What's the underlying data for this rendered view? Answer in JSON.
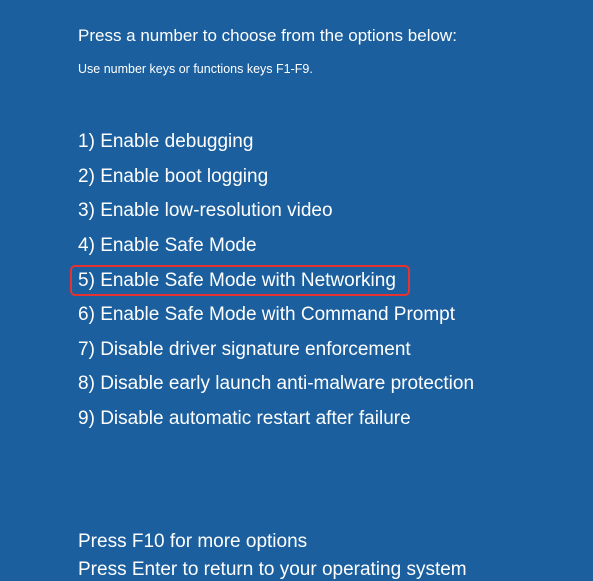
{
  "heading": "Press a number to choose from the options below:",
  "subheading": "Use number keys or functions keys F1-F9.",
  "options": [
    {
      "num": "1)",
      "label": "Enable debugging",
      "highlighted": false
    },
    {
      "num": "2)",
      "label": "Enable boot logging",
      "highlighted": false
    },
    {
      "num": "3)",
      "label": "Enable low-resolution video",
      "highlighted": false
    },
    {
      "num": "4)",
      "label": "Enable Safe Mode",
      "highlighted": false
    },
    {
      "num": "5)",
      "label": "Enable Safe Mode with Networking",
      "highlighted": true
    },
    {
      "num": "6)",
      "label": "Enable Safe Mode with Command Prompt",
      "highlighted": false
    },
    {
      "num": "7)",
      "label": "Disable driver signature enforcement",
      "highlighted": false
    },
    {
      "num": "8)",
      "label": "Disable early launch anti-malware protection",
      "highlighted": false
    },
    {
      "num": "9)",
      "label": "Disable automatic restart after failure",
      "highlighted": false
    }
  ],
  "footer": {
    "line1": "Press F10 for more options",
    "line2": "Press Enter to return to your operating system"
  },
  "highlight_color": "#e73232"
}
